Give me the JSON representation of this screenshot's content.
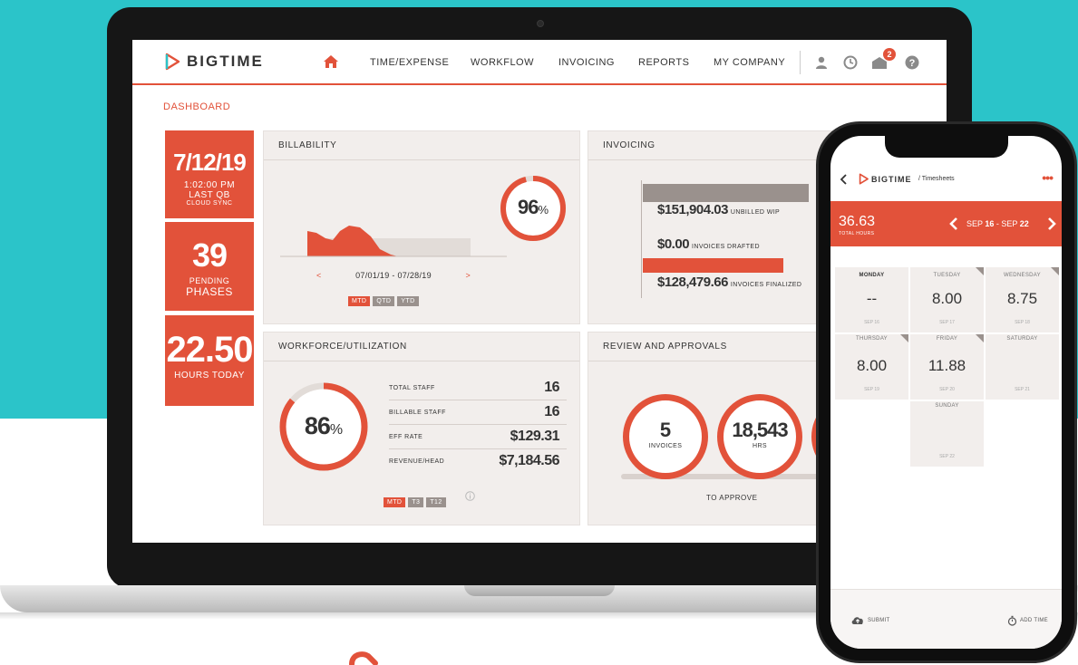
{
  "colors": {
    "accent": "#e2523a",
    "teal": "#2bc4c9",
    "card": "#f2eeec",
    "grey_seg": "#9a918d"
  },
  "brand": {
    "name": "BIGTIME"
  },
  "nav": {
    "home_icon": "home-icon",
    "items": [
      "TIME/EXPENSE",
      "WORKFLOW",
      "INVOICING",
      "REPORTS",
      "MY COMPANY"
    ],
    "icons": [
      "user-icon",
      "clock-icon",
      "inbox-icon",
      "help-icon"
    ],
    "notification_count": "2"
  },
  "breadcrumb": "DASHBOARD",
  "tiles": {
    "date": {
      "big": "7/12/19",
      "line1": "1:02:00 PM",
      "line2": "LAST QB",
      "line3": "CLOUD SYNC"
    },
    "phases": {
      "big": "39",
      "line1": "PENDING",
      "line2": "PHASES"
    },
    "hours": {
      "big": "22.50",
      "line1": "HOURS TODAY"
    }
  },
  "billability": {
    "title": "BILLABILITY",
    "percent": 96,
    "percent_label": "96",
    "percent_sign": "%",
    "prev": "<",
    "next": ">",
    "range": "07/01/19 - 07/28/19",
    "segments": [
      "MTD",
      "QTD",
      "YTD"
    ],
    "active_segment": "MTD"
  },
  "invoicing": {
    "title": "INVOICING",
    "rows": [
      {
        "amount": "$151,904.03",
        "label": "UNBILLED WIP"
      },
      {
        "amount": "$0.00",
        "label": "INVOICES DRAFTED"
      },
      {
        "amount": "$128,479.66",
        "label": "INVOICES FINALIZED"
      }
    ]
  },
  "workforce": {
    "title": "WORKFORCE/UTILIZATION",
    "percent": 86,
    "percent_label": "86",
    "percent_sign": "%",
    "rows": [
      {
        "label": "TOTAL STAFF",
        "value": "16"
      },
      {
        "label": "BILLABLE STAFF",
        "value": "16"
      },
      {
        "label": "EFF RATE",
        "value": "$129.31"
      },
      {
        "label": "REVENUE/HEAD",
        "value": "$7,184.56"
      }
    ],
    "segments": [
      "MTD",
      "T3",
      "T12"
    ],
    "active_segment": "MTD",
    "info_icon": "info-icon"
  },
  "review": {
    "title": "REVIEW AND APPROVALS",
    "items": [
      {
        "value": "5",
        "label": "INVOICES"
      },
      {
        "value": "18,543",
        "label": "HRS"
      }
    ],
    "footer": "TO APPROVE"
  },
  "phone": {
    "brand": "BIGTIME",
    "section": "/ Timesheets",
    "total_hours": "36.63",
    "total_hours_label": "TOTAL HOURS",
    "week_prefix": "SEP ",
    "week_start": "16",
    "week_sep": " - SEP ",
    "week_end": "22",
    "days": [
      {
        "name": "MONDAY",
        "value": "--",
        "date": "SEP 16"
      },
      {
        "name": "TUESDAY",
        "value": "8.00",
        "date": "SEP 17"
      },
      {
        "name": "WEDNESDAY",
        "value": "8.75",
        "date": "SEP 18"
      },
      {
        "name": "THURSDAY",
        "value": "8.00",
        "date": "SEP 19"
      },
      {
        "name": "FRIDAY",
        "value": "11.88",
        "date": "SEP 20"
      },
      {
        "name": "SATURDAY",
        "value": "",
        "date": "SEP 21"
      },
      {
        "name": "SUNDAY",
        "value": "",
        "date": "SEP 22"
      }
    ],
    "submit": "SUBMIT",
    "add_time": "ADD TIME"
  }
}
